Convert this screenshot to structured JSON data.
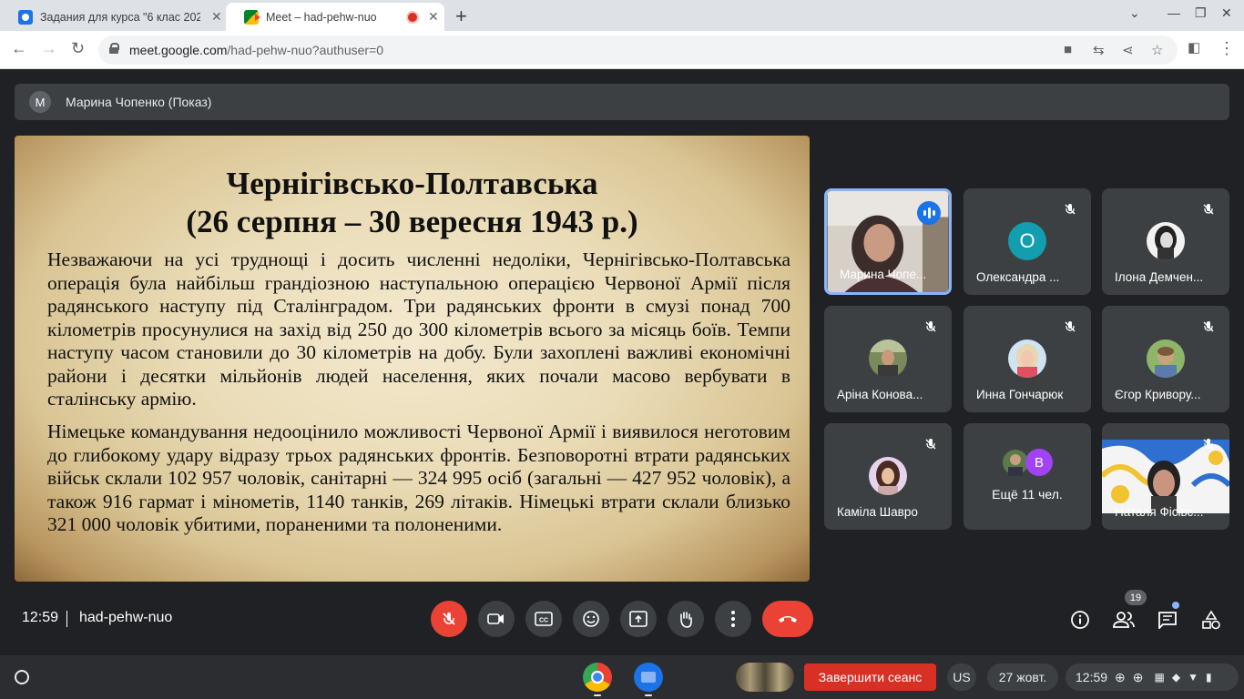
{
  "browser": {
    "tabs": [
      {
        "title": "Задания для курса \"6 клас 202",
        "active": false
      },
      {
        "title": "Meet – had-pehw-nuo",
        "active": true
      }
    ],
    "url_host": "meet.google.com",
    "url_path": "/had-pehw-nuo?authuser=0"
  },
  "meet": {
    "presenter": {
      "initial": "M",
      "label": "Марина Чопенко (Показ)"
    },
    "slide": {
      "title_line1": "Чернігівсько-Полтавська",
      "title_line2": "(26 серпня – 30 вересня 1943 р.)",
      "paragraph1": "Незважаючи на усі труднощі і досить численні недоліки, Чернігівсько-Полтавська операція була найбільш грандіозною наступальною операцією Червоної Армії після радянського наступу під Сталінградом. Три радянських фронти в смузі понад 700 кілометрів просунулися на захід від 250 до 300 кілометрів всього за місяць боїв. Темпи наступу часом становили до 30 кілометрів на добу. Були захоплені важливі економічні райони і десятки мільйонів людей населення, яких почали масово вербувати в сталінську армію.",
      "paragraph2": "Німецьке командування недооцінило можливості Червоної Армії і виявилося неготовим до глибокому удару відразу трьох радянських фронтів. Безповоротні втрати радянських військ склали 102 957 чоловік, санітарні — 324 995 осіб (загальні — 427 952 чоловік), а також 916 гармат і мінометів, 1140 танків, 269 літаків. Німецькі втрати склали близько 321 000 чоловік убитими, пораненими та полоненими."
    },
    "participants": [
      {
        "name": "Марина Чопе...",
        "state": "speaking"
      },
      {
        "name": "Олександра ...",
        "initial": "О",
        "state": "muted"
      },
      {
        "name": "Ілона Демчен...",
        "state": "muted"
      },
      {
        "name": "Аріна Конова...",
        "state": "muted"
      },
      {
        "name": "Инна Гончарюк",
        "state": "muted"
      },
      {
        "name": "Єгор Кривору...",
        "state": "muted"
      },
      {
        "name": "Каміла Шавро",
        "state": "muted"
      },
      {
        "name": "Ещё 11 чел.",
        "initial": "B",
        "state": "group"
      },
      {
        "name": "Наталя Фісівс...",
        "state": "video"
      }
    ],
    "controls": {
      "time": "12:59",
      "meeting_code": "had-pehw-nuo",
      "people_count": "19"
    }
  },
  "shelf": {
    "end_session": "Завершити сеанс",
    "keyboard": "US",
    "date": "27 жовт.",
    "time": "12:59"
  },
  "colors": {
    "meet_bg": "#202124",
    "tile_bg": "#3c4043",
    "danger": "#ea4335",
    "accent": "#8ab4f8"
  }
}
